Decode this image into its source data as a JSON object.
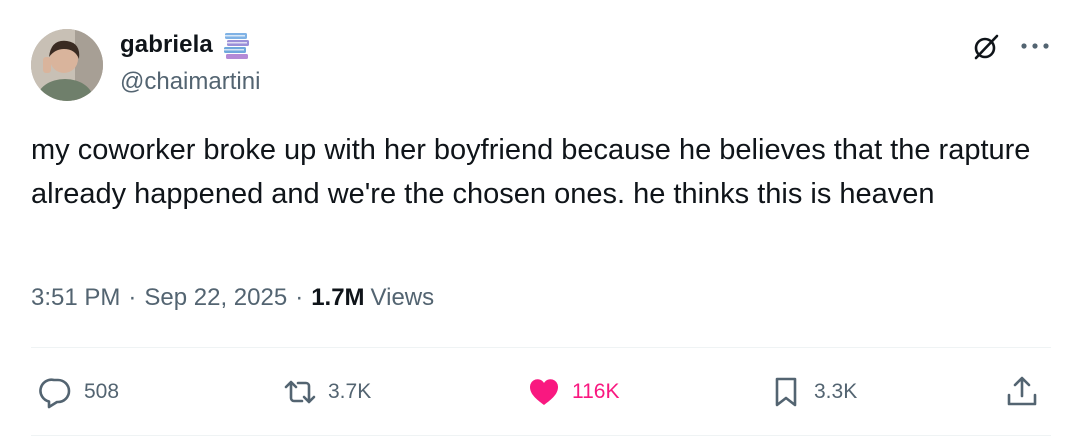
{
  "author": {
    "display_name": "gabriela",
    "handle": "@chaimartini",
    "badge_icon": "books-icon",
    "avatar_icon": "avatar-photo"
  },
  "tweet": {
    "text": "my coworker broke up with her boyfriend because he believes that the rapture already happened and we're the chosen ones. he thinks this is heaven"
  },
  "meta": {
    "time": "3:51 PM",
    "separator": "·",
    "date": "Sep 22, 2025",
    "views_count": "1.7M",
    "views_label": "Views"
  },
  "actions": {
    "reply_count": "508",
    "retweet_count": "3.7K",
    "like_count": "116K",
    "bookmark_count": "3.3K"
  },
  "colors": {
    "text": "#0f1419",
    "secondary": "#536471",
    "like": "#f91880",
    "divider": "#eff3f4"
  }
}
